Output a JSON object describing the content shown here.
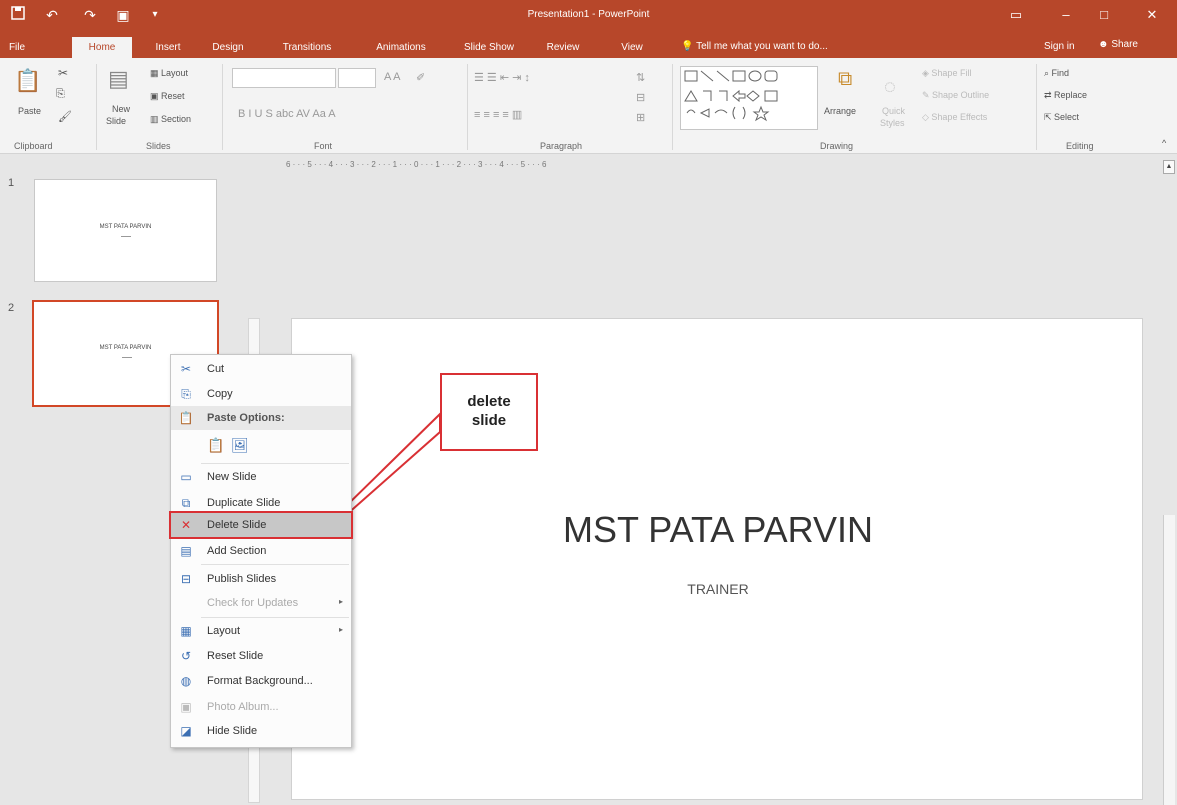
{
  "titlebar": {
    "title": "Presentation1 - PowerPoint",
    "icons": [
      "save-icon",
      "undo-icon",
      "redo-icon",
      "present-icon",
      "customize-icon"
    ]
  },
  "tabs": [
    "File",
    "Home",
    "Insert",
    "Design",
    "Transitions",
    "Animations",
    "Slide Show",
    "Review",
    "View"
  ],
  "tell_me": "Tell me what you want to do...",
  "sign_in": "Sign in",
  "share": "Share",
  "ribbon": {
    "clipboard": {
      "label": "Clipboard",
      "paste": "Paste"
    },
    "slides": {
      "label": "Slides",
      "new_slide": "New",
      "new_slide_2": "Slide",
      "layout": "Layout",
      "reset": "Reset",
      "section": "Section"
    },
    "font": {
      "label": "Font"
    },
    "paragraph": {
      "label": "Paragraph"
    },
    "drawing": {
      "label": "Drawing",
      "arrange": "Arrange",
      "quick_styles": "Quick",
      "quick_styles_2": "Styles",
      "shape_fill": "Shape Fill",
      "shape_outline": "Shape Outline",
      "shape_effects": "Shape Effects"
    },
    "editing": {
      "label": "Editing",
      "find": "Find",
      "replace": "Replace",
      "select": "Select"
    }
  },
  "ruler_text": "6 · · · 5 · · · 4 · · · 3 · · · 2 · · · 1 · · · 0 · · · 1 · · · 2 · · · 3 · · · 4 · · · 5 · · · 6",
  "thumbnails": [
    {
      "num": "1",
      "text": "MST PATA PARVIN"
    },
    {
      "num": "2",
      "text": "MST PATA PARVIN"
    }
  ],
  "slide": {
    "title": "MST PATA PARVIN",
    "subtitle": "TRAINER"
  },
  "context_menu": {
    "cut": "Cut",
    "copy": "Copy",
    "paste_options": "Paste Options:",
    "new_slide": "New Slide",
    "duplicate_slide": "Duplicate Slide",
    "delete_slide": "Delete Slide",
    "add_section": "Add Section",
    "publish_slides": "Publish Slides",
    "check_updates": "Check for Updates",
    "layout": "Layout",
    "reset_slide": "Reset Slide",
    "format_background": "Format Background...",
    "photo_album": "Photo Album...",
    "hide_slide": "Hide Slide"
  },
  "callout": {
    "line1": "delete",
    "line2": "slide"
  },
  "colors": {
    "accent": "#b7472a",
    "highlight": "#d93034"
  }
}
